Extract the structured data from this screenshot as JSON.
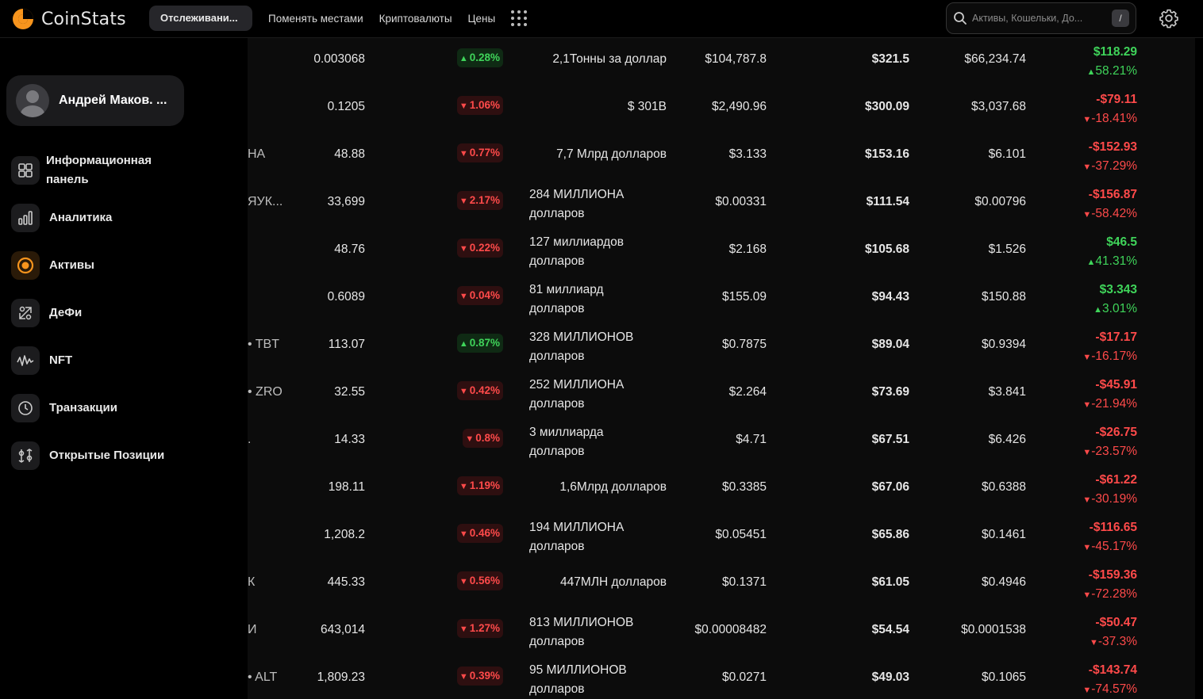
{
  "brand": {
    "name": "CoinStats",
    "accent": "#f7941d"
  },
  "nav": {
    "active_tab": "Отслеживани...",
    "links": [
      "Поменять местами",
      "Криптовалюты",
      "Цены"
    ]
  },
  "search": {
    "placeholder": "Активы, Кошельки, До...",
    "shortcut": "/"
  },
  "user": {
    "name": "Андрей Маков. ..."
  },
  "sidebar": {
    "items": [
      {
        "label": "Информационная панель",
        "icon": "dashboard-icon"
      },
      {
        "label": "Аналитика",
        "icon": "bar-chart-icon"
      },
      {
        "label": "Активы",
        "icon": "coin-icon"
      },
      {
        "label": "ДеФи",
        "icon": "defi-icon"
      },
      {
        "label": "NFT",
        "icon": "nft-wave-icon"
      },
      {
        "label": "Транзакции",
        "icon": "clock-icon"
      },
      {
        "label": "Открытые Позиции",
        "icon": "positions-icon"
      }
    ]
  },
  "colors": {
    "up": "#3fd45a",
    "down": "#ff4a4a"
  },
  "rows": [
    {
      "name": "",
      "amount": "0.003068",
      "change": "0.28%",
      "dir": "up",
      "cap": [
        "2,1Тонны за доллар"
      ],
      "price": "$104,787.8",
      "holdings": "$321.5",
      "avg": "$66,234.74",
      "pnl": "$118.29",
      "pnl_pct": "58.21%",
      "pnl_dir": "up"
    },
    {
      "name": "",
      "amount": "0.1205",
      "change": "1.06%",
      "dir": "down",
      "cap": [
        "$ 301B"
      ],
      "price": "$2,490.96",
      "holdings": "$300.09",
      "avg": "$3,037.68",
      "pnl": "-$79.11",
      "pnl_pct": "-18.41%",
      "pnl_dir": "down"
    },
    {
      "name": "НА",
      "amount": "48.88",
      "change": "0.77%",
      "dir": "down",
      "cap": [
        "7,7 Млрд долларов"
      ],
      "price": "$3.133",
      "holdings": "$153.16",
      "avg": "$6.101",
      "pnl": "-$152.93",
      "pnl_pct": "-37.29%",
      "pnl_dir": "down"
    },
    {
      "name": "ЯУК...",
      "amount": "33,699",
      "change": "2.17%",
      "dir": "down",
      "cap": [
        "284 МИЛЛИОНА",
        "долларов"
      ],
      "price": "$0.00331",
      "holdings": "$111.54",
      "avg": "$0.00796",
      "pnl": "-$156.87",
      "pnl_pct": "-58.42%",
      "pnl_dir": "down"
    },
    {
      "name": "",
      "amount": "48.76",
      "change": "0.22%",
      "dir": "down",
      "cap": [
        "127 миллиардов",
        "долларов"
      ],
      "price": "$2.168",
      "holdings": "$105.68",
      "avg": "$1.526",
      "pnl": "$46.5",
      "pnl_pct": "41.31%",
      "pnl_dir": "up"
    },
    {
      "name": "",
      "amount": "0.6089",
      "change": "0.04%",
      "dir": "down",
      "cap": [
        "81 миллиард",
        "долларов"
      ],
      "price": "$155.09",
      "holdings": "$94.43",
      "avg": "$150.88",
      "pnl": "$3.343",
      "pnl_pct": "3.01%",
      "pnl_dir": "up"
    },
    {
      "name": "• TBT",
      "amount": "113.07",
      "change": "0.87%",
      "dir": "up",
      "cap": [
        "328 МИЛЛИОНОВ",
        "долларов"
      ],
      "price": "$0.7875",
      "holdings": "$89.04",
      "avg": "$0.9394",
      "pnl": "-$17.17",
      "pnl_pct": "-16.17%",
      "pnl_dir": "down"
    },
    {
      "name": "• ZRO",
      "amount": "32.55",
      "change": "0.42%",
      "dir": "down",
      "cap": [
        "252 МИЛЛИОНА",
        "долларов"
      ],
      "price": "$2.264",
      "holdings": "$73.69",
      "avg": "$3.841",
      "pnl": "-$45.91",
      "pnl_pct": "-21.94%",
      "pnl_dir": "down"
    },
    {
      "name": ".",
      "amount": "14.33",
      "change": "0.8%",
      "dir": "down",
      "cap": [
        "3 миллиарда",
        "долларов"
      ],
      "price": "$4.71",
      "holdings": "$67.51",
      "avg": "$6.426",
      "pnl": "-$26.75",
      "pnl_pct": "-23.57%",
      "pnl_dir": "down"
    },
    {
      "name": "",
      "amount": "198.11",
      "change": "1.19%",
      "dir": "down",
      "cap": [
        "1,6Млрд долларов"
      ],
      "price": "$0.3385",
      "holdings": "$67.06",
      "avg": "$0.6388",
      "pnl": "-$61.22",
      "pnl_pct": "-30.19%",
      "pnl_dir": "down"
    },
    {
      "name": "",
      "amount": "1,208.2",
      "change": "0.46%",
      "dir": "down",
      "cap": [
        "194 МИЛЛИОНА",
        "долларов"
      ],
      "price": "$0.05451",
      "holdings": "$65.86",
      "avg": "$0.1461",
      "pnl": "-$116.65",
      "pnl_pct": "-45.17%",
      "pnl_dir": "down"
    },
    {
      "name": "К",
      "amount": "445.33",
      "change": "0.56%",
      "dir": "down",
      "cap": [
        "447МЛН долларов"
      ],
      "price": "$0.1371",
      "holdings": "$61.05",
      "avg": "$0.4946",
      "pnl": "-$159.36",
      "pnl_pct": "-72.28%",
      "pnl_dir": "down"
    },
    {
      "name": "И",
      "amount": "643,014",
      "change": "1.27%",
      "dir": "down",
      "cap": [
        "813 МИЛЛИОНОВ",
        "долларов"
      ],
      "price": "$0.00008482",
      "holdings": "$54.54",
      "avg": "$0.0001538",
      "pnl": "-$50.47",
      "pnl_pct": "-37.3%",
      "pnl_dir": "down"
    },
    {
      "name": "• ALT",
      "amount": "1,809.23",
      "change": "0.39%",
      "dir": "down",
      "cap": [
        "95 МИЛЛИОНОВ",
        "долларов"
      ],
      "price": "$0.0271",
      "holdings": "$49.03",
      "avg": "$0.1065",
      "pnl": "-$143.74",
      "pnl_pct": "-74.57%",
      "pnl_dir": "down"
    }
  ]
}
